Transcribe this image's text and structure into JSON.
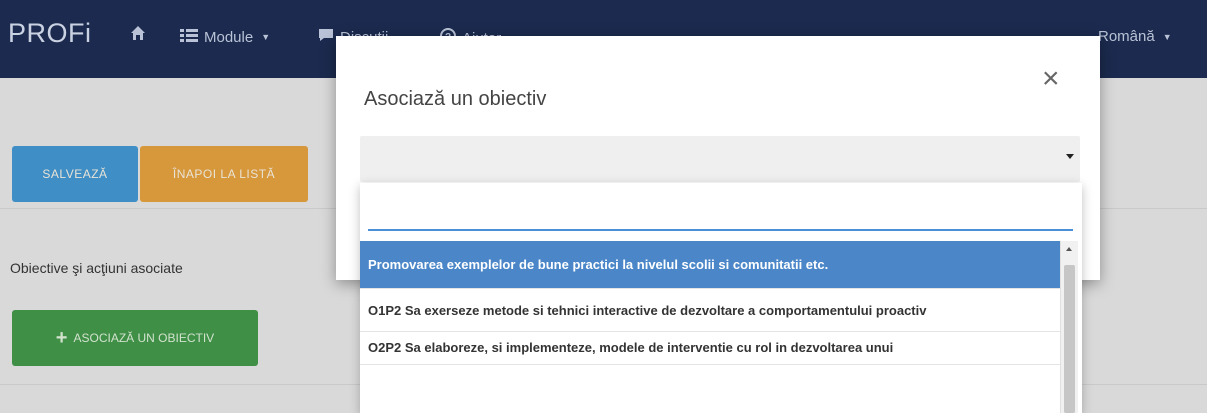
{
  "navbar": {
    "brand": "PROFi",
    "home_icon": "home-icon",
    "module_icon": "list-icon",
    "module_label": "Module",
    "discussions_icon": "chat-icon",
    "discussions_label": "Discuții",
    "help_icon": "help-icon",
    "help_label": "Ajutor",
    "language_label": "Română"
  },
  "page": {
    "save_label": "SALVEAZĂ",
    "back_label": "ÎNAPOI LA LISTĂ",
    "section_label": "Obiective şi acţiuni asociate",
    "associate_button_label": "ASOCIAZĂ UN OBIECTIV"
  },
  "modal": {
    "title": "Asociază un obiectiv",
    "close_glyph": "×",
    "select_value": ""
  },
  "dropdown": {
    "search_value": "",
    "options": [
      "Promovarea exemplelor de bune practici la nivelul scolii si comunitatii etc.",
      "O1P2 Sa exerseze metode si tehnici interactive de dezvoltare a comportamentului proactiv",
      "O2P2 Sa elaboreze, si implementeze, modele de interventie cu rol in dezvoltarea unui"
    ],
    "selected_index": 0
  },
  "colors": {
    "navbar_bg": "#1b2a4e",
    "save_button": "#3f8ec6",
    "back_button": "#d7973b",
    "associate_button": "#3f8f47",
    "selected_option": "#4a86c8",
    "search_underline": "#4a90d9"
  }
}
